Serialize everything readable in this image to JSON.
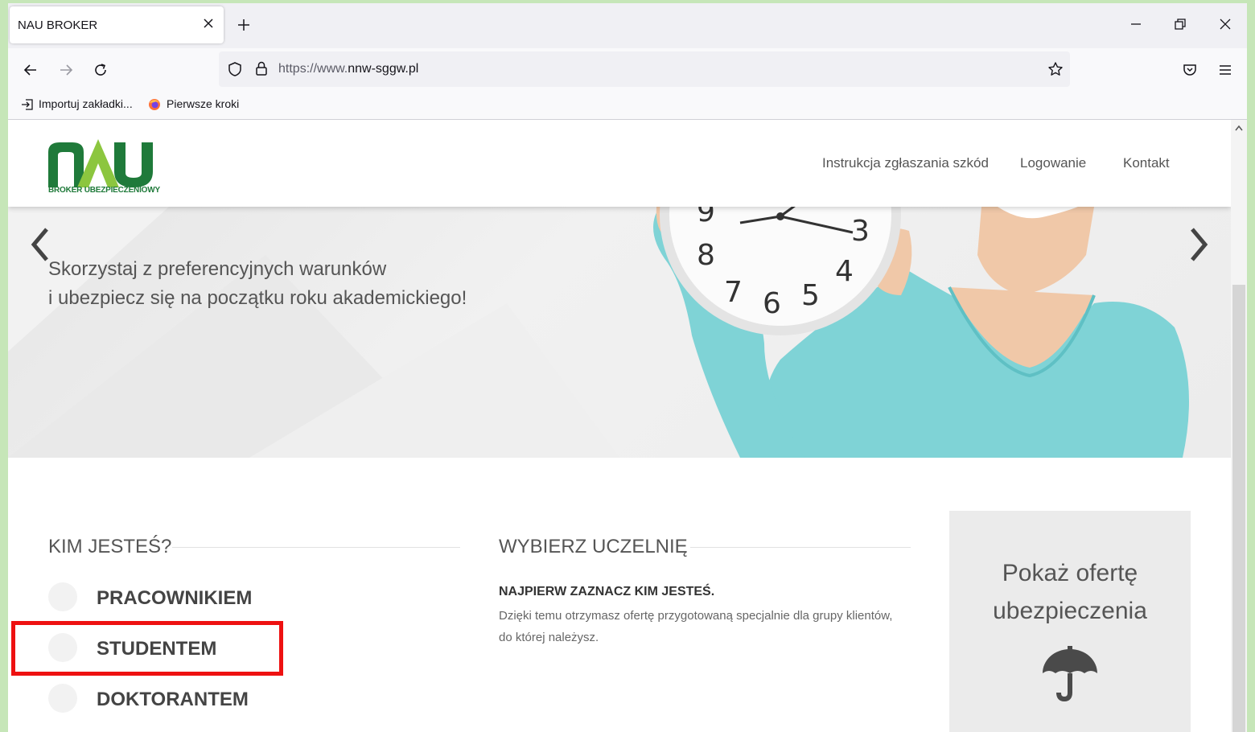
{
  "browser": {
    "tab_title": "NAU BROKER",
    "url_prefix": "https://www.",
    "url_domain": "nnw-sggw.pl",
    "bookmarks": [
      "Importuj zakładki...",
      "Pierwsze kroki"
    ]
  },
  "header": {
    "logo_text": "NAU",
    "logo_subtitle": "BROKER UBEZPIECZENIOWY",
    "menu": [
      "Instrukcja zgłaszania szkód",
      "Logowanie",
      "Kontakt"
    ]
  },
  "hero": {
    "line1": "Skorzystaj z preferencyjnych warunków",
    "line2": "i ubezpiecz się na początku roku akademickiego!"
  },
  "who": {
    "title": "KIM JESTEŚ?",
    "options": [
      "PRACOWNIKIEM",
      "STUDENTEM",
      "DOKTORANTEM"
    ],
    "highlighted": "STUDENTEM"
  },
  "university": {
    "title": "WYBIERZ UCZELNIĘ",
    "instruction_title": "NAJPIERW ZAZNACZ KIM JESTEŚ.",
    "instruction_text": "Dzięki temu otrzymasz ofertę przygotowaną specjalnie dla grupy klientów, do której należysz."
  },
  "offer": {
    "line1": "Pokaż ofertę",
    "line2": "ubezpieczenia"
  },
  "colors": {
    "brand_green": "#1f7a3a",
    "brand_light_green": "#8cc63f",
    "highlight_red": "#ee1111"
  }
}
